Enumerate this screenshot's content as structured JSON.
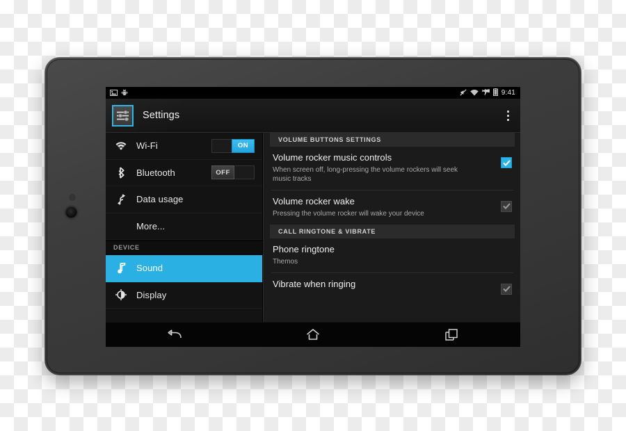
{
  "device": {
    "label": "android-tablet",
    "camera_label": "front-camera"
  },
  "screen": {
    "status_bar": {
      "notification_icons": [
        "screenshot-image-icon",
        "android-bug-icon"
      ],
      "system_icons": [
        "mute-icon",
        "wifi-icon",
        "airplane-mode-icon",
        "battery-icon"
      ],
      "time": "9:41"
    },
    "action_bar": {
      "app_icon": "settings-sliders-icon",
      "title": "Settings",
      "overflow_label": "overflow-menu"
    },
    "sidebar": {
      "items": [
        {
          "id": "wifi",
          "label": "Wi-Fi",
          "icon": "wifi-icon",
          "control": "switch",
          "switch_state": "on",
          "on_label": "ON",
          "off_label": "OFF",
          "selected": false
        },
        {
          "id": "bluetooth",
          "label": "Bluetooth",
          "icon": "bluetooth-icon",
          "control": "switch",
          "switch_state": "off",
          "on_label": "ON",
          "off_label": "OFF",
          "selected": false
        },
        {
          "id": "data-usage",
          "label": "Data usage",
          "icon": "data-usage-icon",
          "control": "none",
          "selected": false
        },
        {
          "id": "more",
          "label": "More...",
          "icon": "none",
          "control": "none",
          "selected": false
        }
      ],
      "section_header": "DEVICE",
      "device_items": [
        {
          "id": "sound",
          "label": "Sound",
          "icon": "music-note-icon",
          "selected": true
        },
        {
          "id": "display",
          "label": "Display",
          "icon": "brightness-icon",
          "selected": false
        }
      ]
    },
    "detail": {
      "sections": [
        {
          "header": "VOLUME BUTTONS SETTINGS",
          "prefs": [
            {
              "id": "volume-rocker-music-controls",
              "title": "Volume rocker music controls",
              "subtitle": "When screen off, long-pressing the volume rockers will seek music tracks",
              "checkbox": "checked-enabled"
            },
            {
              "id": "volume-rocker-wake",
              "title": "Volume rocker wake",
              "subtitle": "Pressing the volume rocker will wake your device",
              "checkbox": "checked-disabled"
            }
          ]
        },
        {
          "header": "CALL RINGTONE & VIBRATE",
          "prefs": [
            {
              "id": "phone-ringtone",
              "title": "Phone ringtone",
              "subtitle": "Themos",
              "checkbox": "none"
            },
            {
              "id": "vibrate-when-ringing",
              "title": "Vibrate when ringing",
              "subtitle": "",
              "checkbox": "checked-disabled"
            }
          ]
        }
      ]
    },
    "nav_bar": {
      "buttons": [
        {
          "id": "back",
          "icon": "back-arrow-icon"
        },
        {
          "id": "home",
          "icon": "home-icon"
        },
        {
          "id": "recents",
          "icon": "recent-apps-icon"
        }
      ]
    }
  },
  "colors": {
    "accent": "#33b5e5",
    "selected_row": "#2ab0e2",
    "checkbox_on": "#2cb3e6",
    "screen_bg": "#0d0d0d",
    "panel_bg": "#1b1b1b"
  }
}
